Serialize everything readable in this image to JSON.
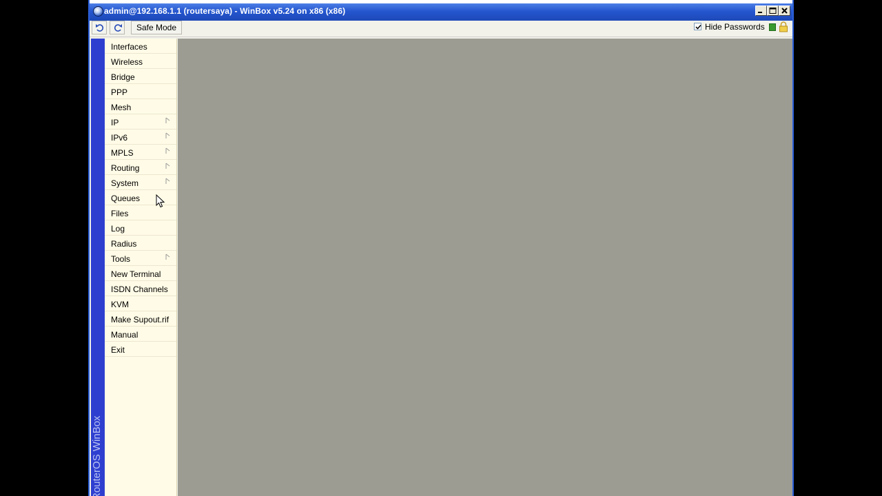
{
  "window": {
    "title": "admin@192.168.1.1 (routersaya) - WinBox v5.24 on x86 (x86)"
  },
  "title_buttons": [
    {
      "name": "minimize-button",
      "icon": "minimize-icon"
    },
    {
      "name": "maximize-button",
      "icon": "maximize-icon"
    },
    {
      "name": "close-button",
      "icon": "close-icon"
    }
  ],
  "toolbar": {
    "undo_icon": "undo-icon",
    "redo_icon": "redo-icon",
    "safe_mode_label": "Safe Mode",
    "hide_passwords_label": "Hide Passwords",
    "hide_passwords_checked": true,
    "status_color": "#3a9a2e",
    "lock_icon": "lock-icon"
  },
  "sidebar": {
    "brand_text": "RouterOS WinBox",
    "strip_color": "#2e3fd0",
    "items": [
      {
        "label": "Interfaces",
        "submenu": false
      },
      {
        "label": "Wireless",
        "submenu": false
      },
      {
        "label": "Bridge",
        "submenu": false
      },
      {
        "label": "PPP",
        "submenu": false
      },
      {
        "label": "Mesh",
        "submenu": false
      },
      {
        "label": "IP",
        "submenu": true
      },
      {
        "label": "IPv6",
        "submenu": true
      },
      {
        "label": "MPLS",
        "submenu": true
      },
      {
        "label": "Routing",
        "submenu": true
      },
      {
        "label": "System",
        "submenu": true
      },
      {
        "label": "Queues",
        "submenu": false
      },
      {
        "label": "Files",
        "submenu": false
      },
      {
        "label": "Log",
        "submenu": false
      },
      {
        "label": "Radius",
        "submenu": false
      },
      {
        "label": "Tools",
        "submenu": true
      },
      {
        "label": "New Terminal",
        "submenu": false
      },
      {
        "label": "ISDN Channels",
        "submenu": false
      },
      {
        "label": "KVM",
        "submenu": false
      },
      {
        "label": "Make Supout.rif",
        "submenu": false
      },
      {
        "label": "Manual",
        "submenu": false
      },
      {
        "label": "Exit",
        "submenu": false
      }
    ]
  },
  "workspace": {
    "background": "#9c9c93"
  }
}
